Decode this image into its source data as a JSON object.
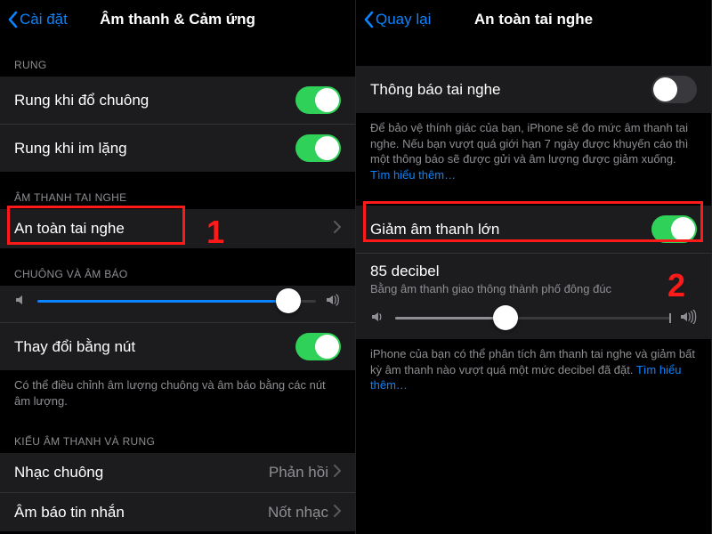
{
  "left": {
    "back": "Cài đặt",
    "title": "Âm thanh & Cảm ứng",
    "sec_rung": "RUNG",
    "row_ring": "Rung khi đổ chuông",
    "row_silent": "Rung khi im lặng",
    "sec_headphone": "ÂM THANH TAI NGHE",
    "row_safety": "An toàn tai nghe",
    "sec_ringer": "CHUÔNG VÀ ÂM BÁO",
    "row_change": "Thay đổi bằng nút",
    "footer_change": "Có thể điều chỉnh âm lượng chuông và âm báo bằng các nút âm lượng.",
    "sec_sounds": "KIỂU ÂM THANH VÀ RUNG",
    "row_ringtone": "Nhạc chuông",
    "row_ringtone_val": "Phản hồi",
    "row_newmail": "Âm báo tin nhắn",
    "row_newmail_val": "Nốt nhạc",
    "annot": "1"
  },
  "right": {
    "back": "Quay lại",
    "title": "An toàn tai nghe",
    "row_notice": "Thông báo tai nghe",
    "footer_notice": "Để bảo vệ thính giác của bạn, iPhone sẽ đo mức âm thanh tai nghe. Nếu bạn vượt quá giới hạn 7 ngày được khuyến cáo thì một thông báo sẽ được gửi và âm lượng được giảm xuống. ",
    "footer_notice_link": "Tìm hiểu thêm…",
    "row_reduce": "Giảm âm thanh lớn",
    "decibel_title": "85 decibel",
    "decibel_sub": "Bằng âm thanh giao thông thành phố đông đúc",
    "footer_reduce": "iPhone của bạn có thể phân tích âm thanh tai nghe và giảm bất kỳ âm thanh nào vượt quá một mức decibel đã đặt. ",
    "footer_reduce_link": "Tìm hiểu thêm…",
    "annot": "2"
  }
}
